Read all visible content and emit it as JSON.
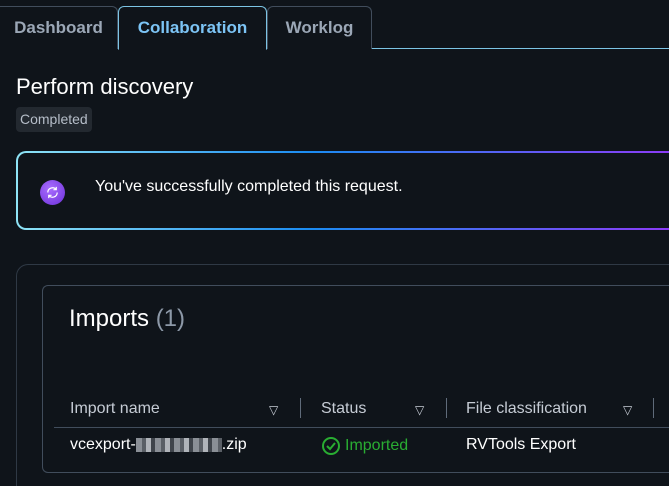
{
  "tabs": [
    {
      "label": "Dashboard"
    },
    {
      "label": "Collaboration",
      "active": true
    },
    {
      "label": "Worklog"
    }
  ],
  "page": {
    "title": "Perform discovery",
    "status_badge": "Completed"
  },
  "alert": {
    "message": "You've successfully completed this request.",
    "icon": "sync-icon"
  },
  "imports": {
    "title": "Imports",
    "count": "(1)",
    "columns": [
      "Import name",
      "Status",
      "File classification"
    ],
    "rows": [
      {
        "name_prefix": "vcexport-",
        "name_suffix": ".zip",
        "status": "Imported",
        "classification": "RVTools Export"
      }
    ]
  },
  "colors": {
    "accent": "#7cc4f5",
    "success": "#29ad32",
    "background": "#0f141a"
  }
}
